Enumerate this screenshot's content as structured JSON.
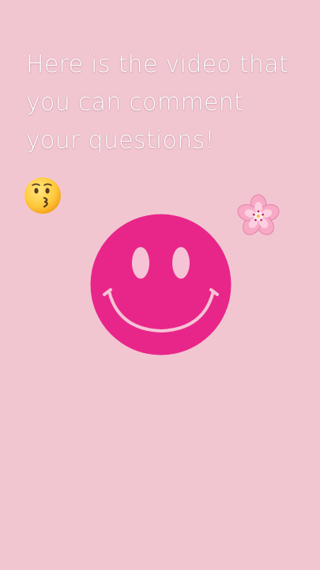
{
  "caption": {
    "lines": [
      "Here is the video that",
      "you can comment",
      "your questions!"
    ]
  },
  "icons": {
    "kiss": "face-blowing-kiss-emoji",
    "flower": "cherry-blossom-emoji",
    "smiley": "pink-smiley-face"
  },
  "colors": {
    "background": "#f2c6d1",
    "smiley_fill": "#e8268a",
    "smiley_features": "#f6c3d6",
    "caption_text": "#ffffff"
  }
}
